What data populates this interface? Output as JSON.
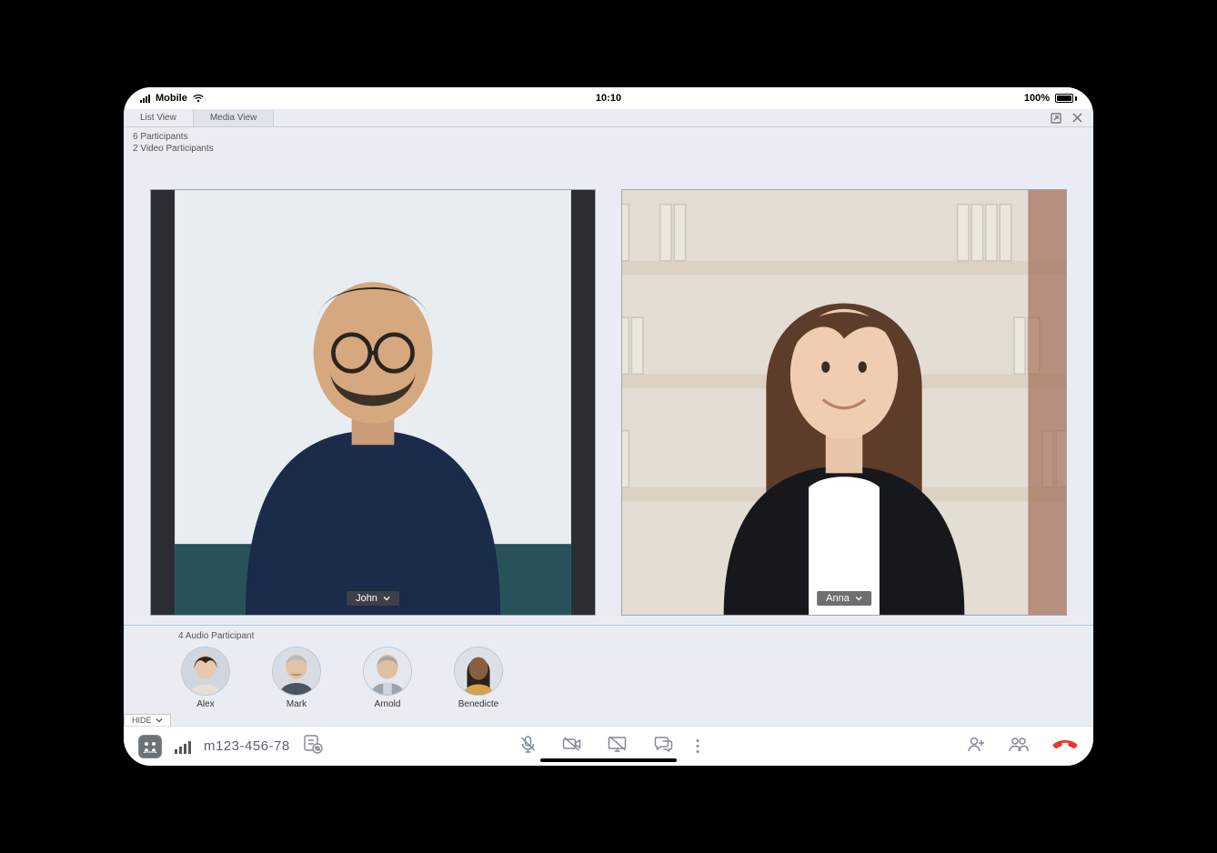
{
  "status": {
    "carrier": "Mobile",
    "time": "10:10",
    "battery_pct": "100%"
  },
  "tabs": {
    "list_view": "List View",
    "media_view": "Media View"
  },
  "info": {
    "participants_line": "6 Participants",
    "video_participants_line": "2 Video Participants"
  },
  "video": {
    "tiles": [
      {
        "name": "John"
      },
      {
        "name": "Anna"
      }
    ]
  },
  "audio": {
    "label": "4 Audio Participant",
    "items": [
      {
        "name": "Alex"
      },
      {
        "name": "Mark"
      },
      {
        "name": "Arnold"
      },
      {
        "name": "Benedicte"
      }
    ]
  },
  "hide_toggle": "HIDE",
  "bottom": {
    "call_id": "m123-456-78"
  }
}
